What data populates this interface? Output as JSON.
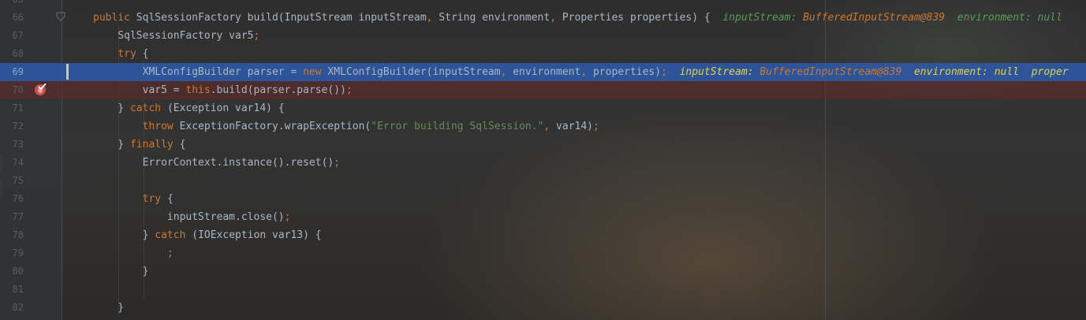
{
  "editor": {
    "lines": [
      {
        "num": "66",
        "segments": [
          {
            "t": "public ",
            "c": "kw"
          },
          {
            "t": "SqlSessionFactory build(InputStream inputStream",
            "c": "cls"
          },
          {
            "t": ", ",
            "c": "punct"
          },
          {
            "t": "String environment",
            "c": "cls"
          },
          {
            "t": ", ",
            "c": "punct"
          },
          {
            "t": "Properties properties) {  ",
            "c": "cls"
          },
          {
            "t": "inputStream: ",
            "c": "inl"
          },
          {
            "t": "BufferedInputStream@839",
            "c": "inl-orange"
          },
          {
            "t": "  environment: null",
            "c": "inl"
          }
        ]
      },
      {
        "num": "67",
        "segments": [
          {
            "t": "    SqlSessionFactory var5",
            "c": "cls"
          },
          {
            "t": ";",
            "c": "punct"
          }
        ]
      },
      {
        "num": "68",
        "segments": [
          {
            "t": "    ",
            "c": "cls"
          },
          {
            "t": "try ",
            "c": "kw"
          },
          {
            "t": "{",
            "c": "cls"
          }
        ]
      },
      {
        "num": "69",
        "state": "exec",
        "segments": [
          {
            "t": "        XMLConfigBuilder parser = ",
            "c": "cls"
          },
          {
            "t": "new ",
            "c": "kw"
          },
          {
            "t": "XMLConfigBuilder(inputStream",
            "c": "cls"
          },
          {
            "t": ", ",
            "c": "punct"
          },
          {
            "t": "environment",
            "c": "cls"
          },
          {
            "t": ", ",
            "c": "punct"
          },
          {
            "t": "properties)",
            "c": "cls"
          },
          {
            "t": ";  ",
            "c": "punct"
          },
          {
            "t": "inputStream: ",
            "c": "inl-yellow"
          },
          {
            "t": "BufferedInputStream@839",
            "c": "inl-orange"
          },
          {
            "t": "  environment: null  proper",
            "c": "inl-yellow"
          }
        ]
      },
      {
        "num": "70",
        "state": "bp",
        "segments": [
          {
            "t": "        var5 = ",
            "c": "cls"
          },
          {
            "t": "this",
            "c": "kw"
          },
          {
            "t": ".build(parser.parse())",
            "c": "cls"
          },
          {
            "t": ";",
            "c": "punct"
          }
        ]
      },
      {
        "num": "71",
        "segments": [
          {
            "t": "    } ",
            "c": "cls"
          },
          {
            "t": "catch ",
            "c": "kw"
          },
          {
            "t": "(Exception var14) {",
            "c": "cls"
          }
        ]
      },
      {
        "num": "72",
        "segments": [
          {
            "t": "        ",
            "c": "cls"
          },
          {
            "t": "throw ",
            "c": "kw"
          },
          {
            "t": "ExceptionFactory.wrapException(",
            "c": "cls"
          },
          {
            "t": "\"Error building SqlSession.\"",
            "c": "str"
          },
          {
            "t": ", ",
            "c": "punct"
          },
          {
            "t": "var14)",
            "c": "cls"
          },
          {
            "t": ";",
            "c": "punct"
          }
        ]
      },
      {
        "num": "73",
        "segments": [
          {
            "t": "    } ",
            "c": "cls"
          },
          {
            "t": "finally ",
            "c": "kw"
          },
          {
            "t": "{",
            "c": "cls"
          }
        ]
      },
      {
        "num": "74",
        "segments": [
          {
            "t": "        ErrorContext.instance().reset()",
            "c": "cls"
          },
          {
            "t": ";",
            "c": "punct"
          }
        ]
      },
      {
        "num": "75",
        "segments": []
      },
      {
        "num": "76",
        "segments": [
          {
            "t": "        ",
            "c": "cls"
          },
          {
            "t": "try ",
            "c": "kw"
          },
          {
            "t": "{",
            "c": "cls"
          }
        ]
      },
      {
        "num": "77",
        "segments": [
          {
            "t": "            inputStream.close()",
            "c": "cls"
          },
          {
            "t": ";",
            "c": "punct"
          }
        ]
      },
      {
        "num": "78",
        "segments": [
          {
            "t": "        } ",
            "c": "cls"
          },
          {
            "t": "catch ",
            "c": "kw"
          },
          {
            "t": "(IOException var13) {",
            "c": "cls"
          }
        ]
      },
      {
        "num": "79",
        "segments": [
          {
            "t": "            ",
            "c": "cls"
          },
          {
            "t": ";",
            "c": "punct"
          }
        ]
      },
      {
        "num": "80",
        "segments": [
          {
            "t": "        }",
            "c": "cls"
          }
        ]
      },
      {
        "num": "81",
        "segments": []
      },
      {
        "num": "82",
        "segments": [
          {
            "t": "    }",
            "c": "cls"
          }
        ]
      }
    ],
    "first_partial_line": "65"
  },
  "icons": {
    "breakpoint": "breakpoint-check-icon",
    "fold": "fold-marker-icon"
  },
  "colors": {
    "background": "#2b2b2b",
    "keyword": "#cc7832",
    "string": "#6a8759",
    "text": "#a9b7c6",
    "exec_line": "#2d5aaa",
    "breakpoint_line": "#642828",
    "breakpoint": "#c75450",
    "inline_value": "#e7d246"
  }
}
